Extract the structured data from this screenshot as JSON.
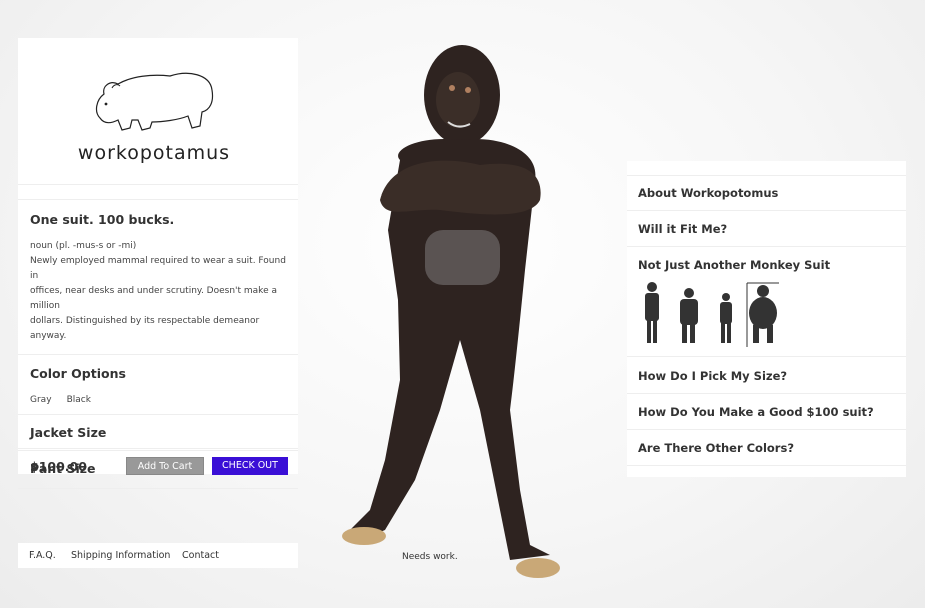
{
  "brand": {
    "name": "workopotamus",
    "logo_icon": "hippo-icon"
  },
  "product": {
    "tagline": "One suit. 100 bucks.",
    "definition_line1": "noun (pl. -mus-s or -mi)",
    "definition_line2": "Newly employed mammal required to wear a suit. Found in",
    "definition_line3": "offices, near desks and under scrutiny. Doesn't make a million",
    "definition_line4": "dollars. Distinguished by its respectable demeanor anyway.",
    "color_options_label": "Color Options",
    "colors": [
      "Gray",
      "Black"
    ],
    "jacket_size_label": "Jacket Size",
    "pant_size_label": "Pant Size",
    "price": "$100.00",
    "add_to_cart_label": "Add To Cart",
    "checkout_label": "CHECK OUT"
  },
  "footer": {
    "links": [
      "F.A.Q.",
      "Shipping Information",
      "Contact"
    ]
  },
  "hero": {
    "caption": "Needs work."
  },
  "faq": {
    "items": [
      "About Workopotomus",
      "Will it Fit Me?",
      "Not Just Another Monkey Suit",
      "How Do I Pick My Size?",
      "How Do You Make a Good $100 suit?",
      "Are There Other Colors?"
    ],
    "silhouettes": [
      "man-silhouette-icon",
      "man-silhouette-icon",
      "man-silhouette-icon",
      "gorilla-silhouette-icon"
    ]
  },
  "colors": {
    "checkout": "#3a0fd6",
    "add_to_cart": "#999999",
    "fur": "#2e2320"
  }
}
